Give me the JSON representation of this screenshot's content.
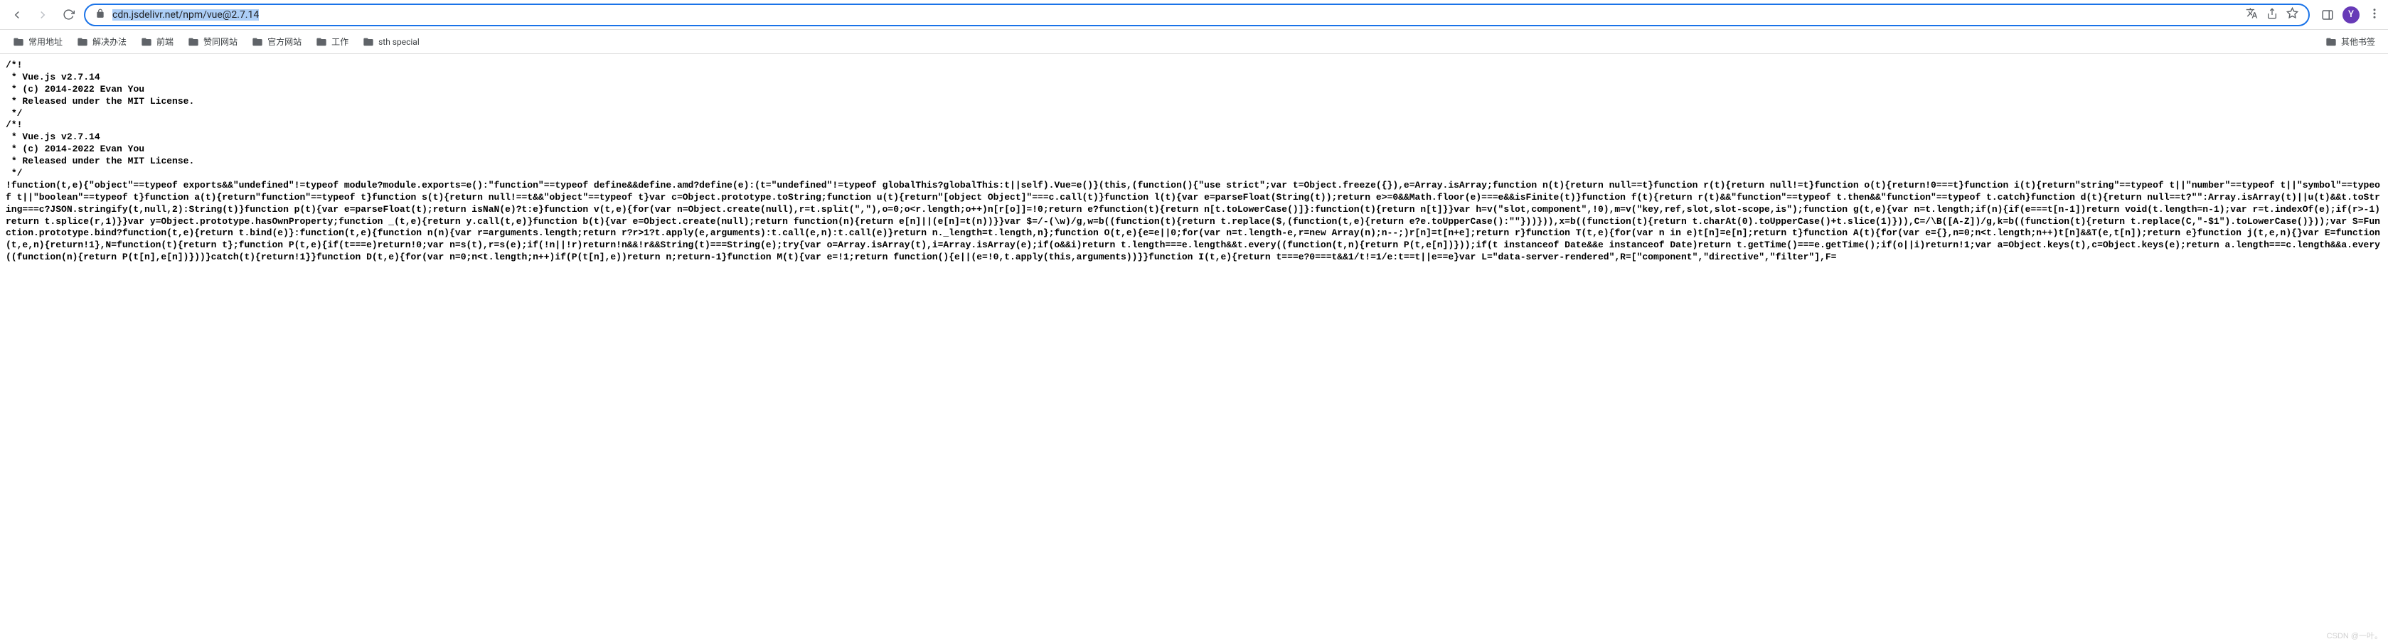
{
  "browser": {
    "url_display_protocol": "",
    "url_display_host_selected": "cdn.jsdelivr.net/npm/vue@2.7.14",
    "profile_letter": "Y"
  },
  "bookmarks": {
    "items": [
      {
        "label": "常用地址"
      },
      {
        "label": "解决办法"
      },
      {
        "label": "前端"
      },
      {
        "label": "赞同网站"
      },
      {
        "label": "官方网站"
      },
      {
        "label": "工作"
      },
      {
        "label": "sth special"
      }
    ],
    "overflow": "其他书签"
  },
  "page_content": {
    "text": "/*!\n * Vue.js v2.7.14\n * (c) 2014-2022 Evan You\n * Released under the MIT License.\n */\n/*!\n * Vue.js v2.7.14\n * (c) 2014-2022 Evan You\n * Released under the MIT License.\n */\n!function(t,e){\"object\"==typeof exports&&\"undefined\"!=typeof module?module.exports=e():\"function\"==typeof define&&define.amd?define(e):(t=\"undefined\"!=typeof globalThis?globalThis:t||self).Vue=e()}(this,(function(){\"use strict\";var t=Object.freeze({}),e=Array.isArray;function n(t){return null==t}function r(t){return null!=t}function o(t){return!0===t}function i(t){return\"string\"==typeof t||\"number\"==typeof t||\"symbol\"==typeof t||\"boolean\"==typeof t}function a(t){return\"function\"==typeof t}function s(t){return null!==t&&\"object\"==typeof t}var c=Object.prototype.toString;function u(t){return\"[object Object]\"===c.call(t)}function l(t){var e=parseFloat(String(t));return e>=0&&Math.floor(e)===e&&isFinite(t)}function f(t){return r(t)&&\"function\"==typeof t.then&&\"function\"==typeof t.catch}function d(t){return null==t?\"\":Array.isArray(t)||u(t)&&t.toString===c?JSON.stringify(t,null,2):String(t)}function p(t){var e=parseFloat(t);return isNaN(e)?t:e}function v(t,e){for(var n=Object.create(null),r=t.split(\",\"),o=0;o<r.length;o++)n[r[o]]=!0;return e?function(t){return n[t.toLowerCase()]}:function(t){return n[t]}}var h=v(\"slot,component\",!0),m=v(\"key,ref,slot,slot-scope,is\");function g(t,e){var n=t.length;if(n){if(e===t[n-1])return void(t.length=n-1);var r=t.indexOf(e);if(r>-1)return t.splice(r,1)}}var y=Object.prototype.hasOwnProperty;function _(t,e){return y.call(t,e)}function b(t){var e=Object.create(null);return function(n){return e[n]||(e[n]=t(n))}}var $=/-(\\w)/g,w=b((function(t){return t.replace($,(function(t,e){return e?e.toUpperCase():\"\"}))})),x=b((function(t){return t.charAt(0).toUpperCase()+t.slice(1)})),C=/\\B([A-Z])/g,k=b((function(t){return t.replace(C,\"-$1\").toLowerCase()}));var S=Function.prototype.bind?function(t,e){return t.bind(e)}:function(t,e){function n(n){var r=arguments.length;return r?r>1?t.apply(e,arguments):t.call(e,n):t.call(e)}return n._length=t.length,n};function O(t,e){e=e||0;for(var n=t.length-e,r=new Array(n);n--;)r[n]=t[n+e];return r}function T(t,e){for(var n in e)t[n]=e[n];return t}function A(t){for(var e={},n=0;n<t.length;n++)t[n]&&T(e,t[n]);return e}function j(t,e,n){}var E=function(t,e,n){return!1},N=function(t){return t};function P(t,e){if(t===e)return!0;var n=s(t),r=s(e);if(!n||!r)return!n&&!r&&String(t)===String(e);try{var o=Array.isArray(t),i=Array.isArray(e);if(o&&i)return t.length===e.length&&t.every((function(t,n){return P(t,e[n])}));if(t instanceof Date&&e instanceof Date)return t.getTime()===e.getTime();if(o||i)return!1;var a=Object.keys(t),c=Object.keys(e);return a.length===c.length&&a.every((function(n){return P(t[n],e[n])}))}catch(t){return!1}}function D(t,e){for(var n=0;n<t.length;n++)if(P(t[n],e))return n;return-1}function M(t){var e=!1;return function(){e||(e=!0,t.apply(this,arguments))}}function I(t,e){return t===e?0===t&&1/t!=1/e:t==t||e==e}var L=\"data-server-rendered\",R=[\"component\",\"directive\",\"filter\"],F="
  },
  "watermark": "CSDN @一叶。"
}
